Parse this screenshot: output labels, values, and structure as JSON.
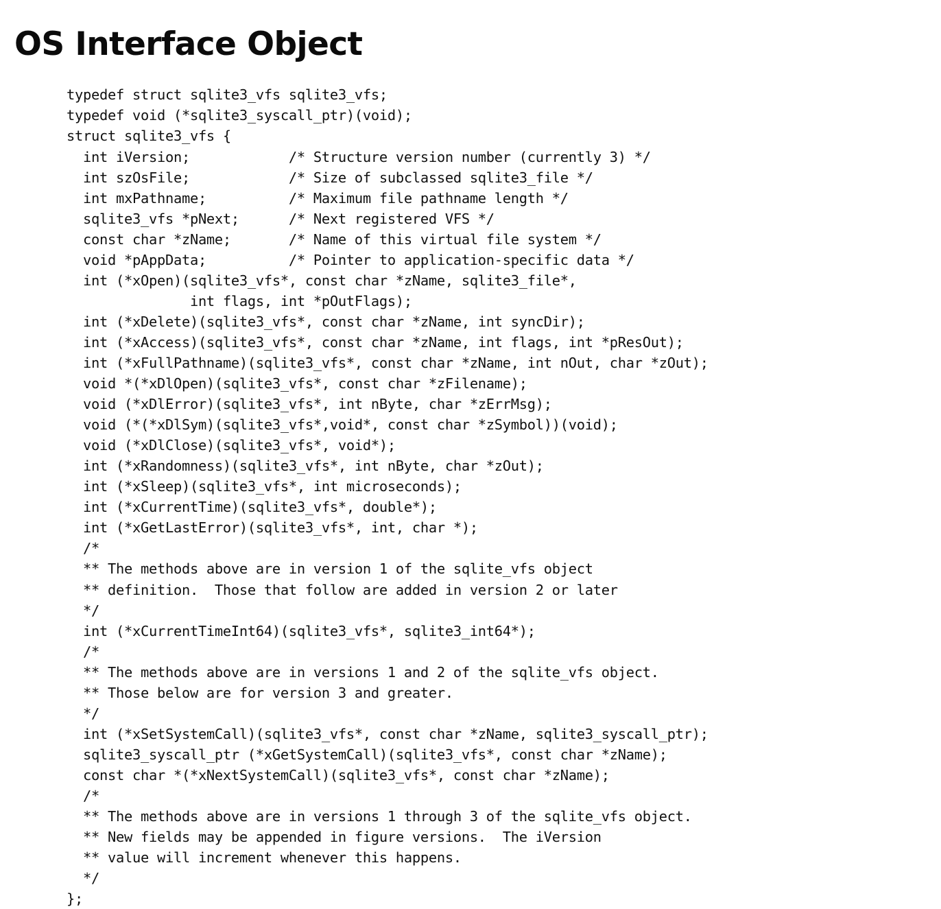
{
  "slide": {
    "title": "OS Interface Object",
    "background_color": "#ffffff",
    "text_color": "#111111",
    "title_color": "#0b0b0b"
  },
  "code": {
    "language": "c",
    "lines": [
      "typedef struct sqlite3_vfs sqlite3_vfs;",
      "typedef void (*sqlite3_syscall_ptr)(void);",
      "struct sqlite3_vfs {",
      "  int iVersion;            /* Structure version number (currently 3) */",
      "  int szOsFile;            /* Size of subclassed sqlite3_file */",
      "  int mxPathname;          /* Maximum file pathname length */",
      "  sqlite3_vfs *pNext;      /* Next registered VFS */",
      "  const char *zName;       /* Name of this virtual file system */",
      "  void *pAppData;          /* Pointer to application-specific data */",
      "  int (*xOpen)(sqlite3_vfs*, const char *zName, sqlite3_file*,",
      "               int flags, int *pOutFlags);",
      "  int (*xDelete)(sqlite3_vfs*, const char *zName, int syncDir);",
      "  int (*xAccess)(sqlite3_vfs*, const char *zName, int flags, int *pResOut);",
      "  int (*xFullPathname)(sqlite3_vfs*, const char *zName, int nOut, char *zOut);",
      "  void *(*xDlOpen)(sqlite3_vfs*, const char *zFilename);",
      "  void (*xDlError)(sqlite3_vfs*, int nByte, char *zErrMsg);",
      "  void (*(*xDlSym)(sqlite3_vfs*,void*, const char *zSymbol))(void);",
      "  void (*xDlClose)(sqlite3_vfs*, void*);",
      "  int (*xRandomness)(sqlite3_vfs*, int nByte, char *zOut);",
      "  int (*xSleep)(sqlite3_vfs*, int microseconds);",
      "  int (*xCurrentTime)(sqlite3_vfs*, double*);",
      "  int (*xGetLastError)(sqlite3_vfs*, int, char *);",
      "  /*",
      "  ** The methods above are in version 1 of the sqlite_vfs object",
      "  ** definition.  Those that follow are added in version 2 or later",
      "  */",
      "  int (*xCurrentTimeInt64)(sqlite3_vfs*, sqlite3_int64*);",
      "  /*",
      "  ** The methods above are in versions 1 and 2 of the sqlite_vfs object.",
      "  ** Those below are for version 3 and greater.",
      "  */",
      "  int (*xSetSystemCall)(sqlite3_vfs*, const char *zName, sqlite3_syscall_ptr);",
      "  sqlite3_syscall_ptr (*xGetSystemCall)(sqlite3_vfs*, const char *zName);",
      "  const char *(*xNextSystemCall)(sqlite3_vfs*, const char *zName);",
      "  /*",
      "  ** The methods above are in versions 1 through 3 of the sqlite_vfs object.",
      "  ** New fields may be appended in figure versions.  The iVersion",
      "  ** value will increment whenever this happens.",
      "  */",
      "};"
    ]
  }
}
